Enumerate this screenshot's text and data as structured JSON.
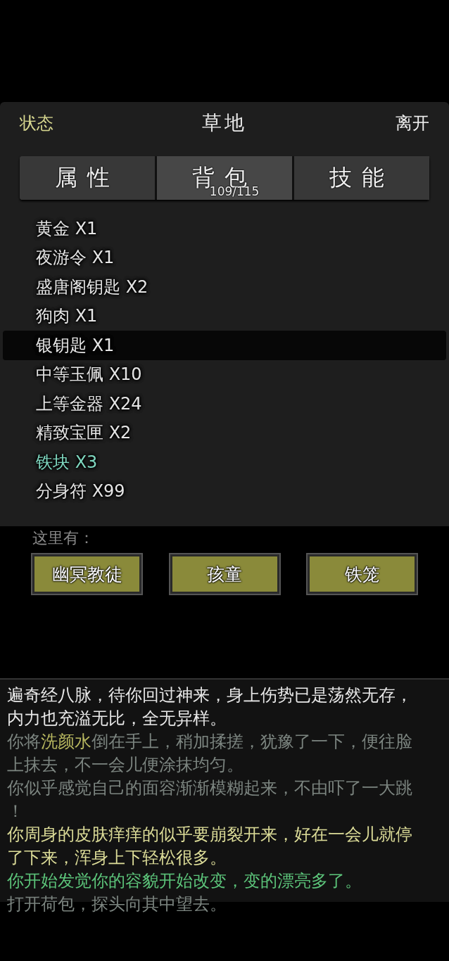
{
  "header": {
    "left": "状态",
    "title": "草地",
    "right": "离开"
  },
  "tabs": [
    {
      "label": "属性",
      "selected": false
    },
    {
      "label": "背包",
      "selected": true,
      "count": "109/115"
    },
    {
      "label": "技能",
      "selected": false
    }
  ],
  "items": [
    {
      "label": "黄金 X1",
      "selected": false,
      "kind": "normal"
    },
    {
      "label": "夜游令 X1",
      "selected": false,
      "kind": "normal"
    },
    {
      "label": "盛唐阁钥匙 X2",
      "selected": false,
      "kind": "normal"
    },
    {
      "label": "狗肉 X1",
      "selected": false,
      "kind": "normal"
    },
    {
      "label": "银钥匙 X1",
      "selected": true,
      "kind": "normal"
    },
    {
      "label": "中等玉佩 X10",
      "selected": false,
      "kind": "normal"
    },
    {
      "label": "上等金器 X24",
      "selected": false,
      "kind": "normal"
    },
    {
      "label": "精致宝匣 X2",
      "selected": false,
      "kind": "normal"
    },
    {
      "label": "铁块 X3",
      "selected": false,
      "kind": "special"
    },
    {
      "label": "分身符 X99",
      "selected": false,
      "kind": "normal"
    }
  ],
  "here": {
    "label": "这里有：",
    "npcs": [
      "幽冥教徒",
      "孩童",
      "铁笼"
    ]
  },
  "log": [
    {
      "parts": [
        {
          "text": "遍奇经八脉，待你回过神来，身上伤势已是荡然无存，内力也充溢无比，全无异样。",
          "color": "#e8e8e8"
        }
      ]
    },
    {
      "parts": [
        {
          "text": "你将",
          "color": "#7c8580"
        },
        {
          "text": "洗颜水",
          "color": "#b8b860"
        },
        {
          "text": "倒在手上，稍加揉搓，犹豫了一下，便往脸上抹去，不一会儿便涂抹均匀。",
          "color": "#7c8580"
        }
      ]
    },
    {
      "parts": [
        {
          "text": "你似乎感觉自己的面容渐渐模糊起来，不由吓了一大跳！",
          "color": "#7c8580"
        }
      ]
    },
    {
      "parts": [
        {
          "text": "你周身的皮肤痒痒的似乎要崩裂开来，好在一会儿就停了下来，浑身上下轻松很多。",
          "color": "#dcdc98"
        }
      ]
    },
    {
      "parts": [
        {
          "text": "你开始发觉你的容貌开始改变，变的漂亮多了。",
          "color": "#5cc47a"
        }
      ]
    },
    {
      "parts": [
        {
          "text": "打开荷包，探头向其中望去。",
          "color": "#7c8580"
        }
      ]
    }
  ]
}
